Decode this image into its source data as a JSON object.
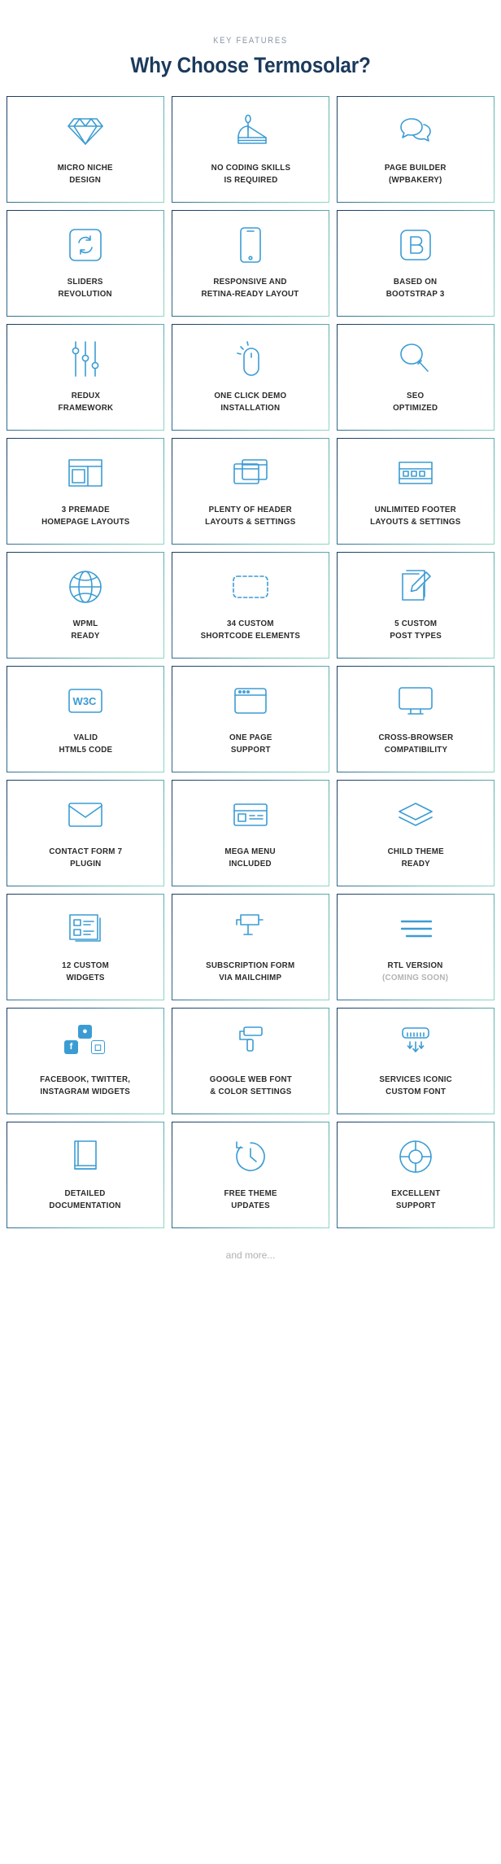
{
  "header": {
    "eyebrow": "KEY FEATURES",
    "headline": "Why Choose Termosolar?"
  },
  "footer": {
    "note": "and more..."
  },
  "colors": {
    "icon": "#3b9cd4",
    "label": "#2b2b2b",
    "muted": "#b3b3b3",
    "headline": "#1b3a5c",
    "eyebrow": "#8b97a6",
    "border_start": "#1b3a5c",
    "border_end": "#8fd6c4",
    "background": "#ffffff"
  },
  "grid": {
    "columns": 3,
    "rows": 10,
    "cards": [
      {
        "icon": "diamond-icon",
        "label": "MICRO NICHE\nDESIGN"
      },
      {
        "icon": "cake-slice-icon",
        "label": "NO CODING SKILLS\nIS REQUIRED"
      },
      {
        "icon": "speech-bubbles-icon",
        "label": "PAGE BUILDER\n(WPBAKERY)"
      },
      {
        "icon": "refresh-square-icon",
        "label": "SLIDERS\nREVOLUTION"
      },
      {
        "icon": "smartphone-icon",
        "label": "RESPONSIVE AND\nRETINA-READY LAYOUT"
      },
      {
        "icon": "bootstrap-b-icon",
        "label": "BASED ON\nBOOTSTRAP 3"
      },
      {
        "icon": "sliders-icon",
        "label": "REDUX\nFRAMEWORK"
      },
      {
        "icon": "mouse-click-icon",
        "label": "ONE CLICK DEMO\nINSTALLATION"
      },
      {
        "icon": "magnifier-icon",
        "label": "SEO\nOPTIMIZED"
      },
      {
        "icon": "layout-grid-icon",
        "label": "3 PREMADE\nHOMEPAGE LAYOUTS"
      },
      {
        "icon": "stacked-windows-icon",
        "label": "PLENTY OF HEADER\nLAYOUTS & SETTINGS"
      },
      {
        "icon": "footer-blocks-icon",
        "label": "UNLIMITED FOOTER\nLAYOUTS & SETTINGS"
      },
      {
        "icon": "globe-icon",
        "label": "WPML\nREADY"
      },
      {
        "icon": "dashed-box-icon",
        "label": "34 CUSTOM\nSHORTCODE ELEMENTS"
      },
      {
        "icon": "pencil-pages-icon",
        "label": "5 CUSTOM\nPOST TYPES"
      },
      {
        "icon": "w3c-badge-icon",
        "label": "VALID\nHTML5 CODE"
      },
      {
        "icon": "browser-window-icon",
        "label": "ONE PAGE\nSUPPORT"
      },
      {
        "icon": "monitor-icon",
        "label": "CROSS-BROWSER\nCOMPATIBILITY"
      },
      {
        "icon": "envelope-icon",
        "label": "CONTACT FORM 7\nPLUGIN"
      },
      {
        "icon": "mega-menu-icon",
        "label": "MEGA MENU\nINCLUDED"
      },
      {
        "icon": "layers-icon",
        "label": "CHILD THEME\nREADY"
      },
      {
        "icon": "widget-list-icon",
        "label": "12 CUSTOM\nWIDGETS"
      },
      {
        "icon": "mailbox-icon",
        "label": "SUBSCRIPTION FORM\nVIA MAILCHIMP"
      },
      {
        "icon": "text-lines-rtl-icon",
        "label": "RTL VERSION",
        "sublabel": "(COMING SOON)"
      },
      {
        "icon": "social-icons-cluster",
        "label": "FACEBOOK, TWITTER,\nINSTAGRAM WIDGETS"
      },
      {
        "icon": "paint-roller-icon",
        "label": "GOOGLE WEB FONT\n& COLOR SETTINGS"
      },
      {
        "icon": "radiator-icon",
        "label": "SERVICES ICONIC\nCUSTOM FONT"
      },
      {
        "icon": "book-icon",
        "label": "DETAILED\nDOCUMENTATION"
      },
      {
        "icon": "clock-refresh-icon",
        "label": "FREE THEME\nUPDATES"
      },
      {
        "icon": "lifebuoy-icon",
        "label": "EXCELLENT\nSUPPORT"
      }
    ]
  }
}
